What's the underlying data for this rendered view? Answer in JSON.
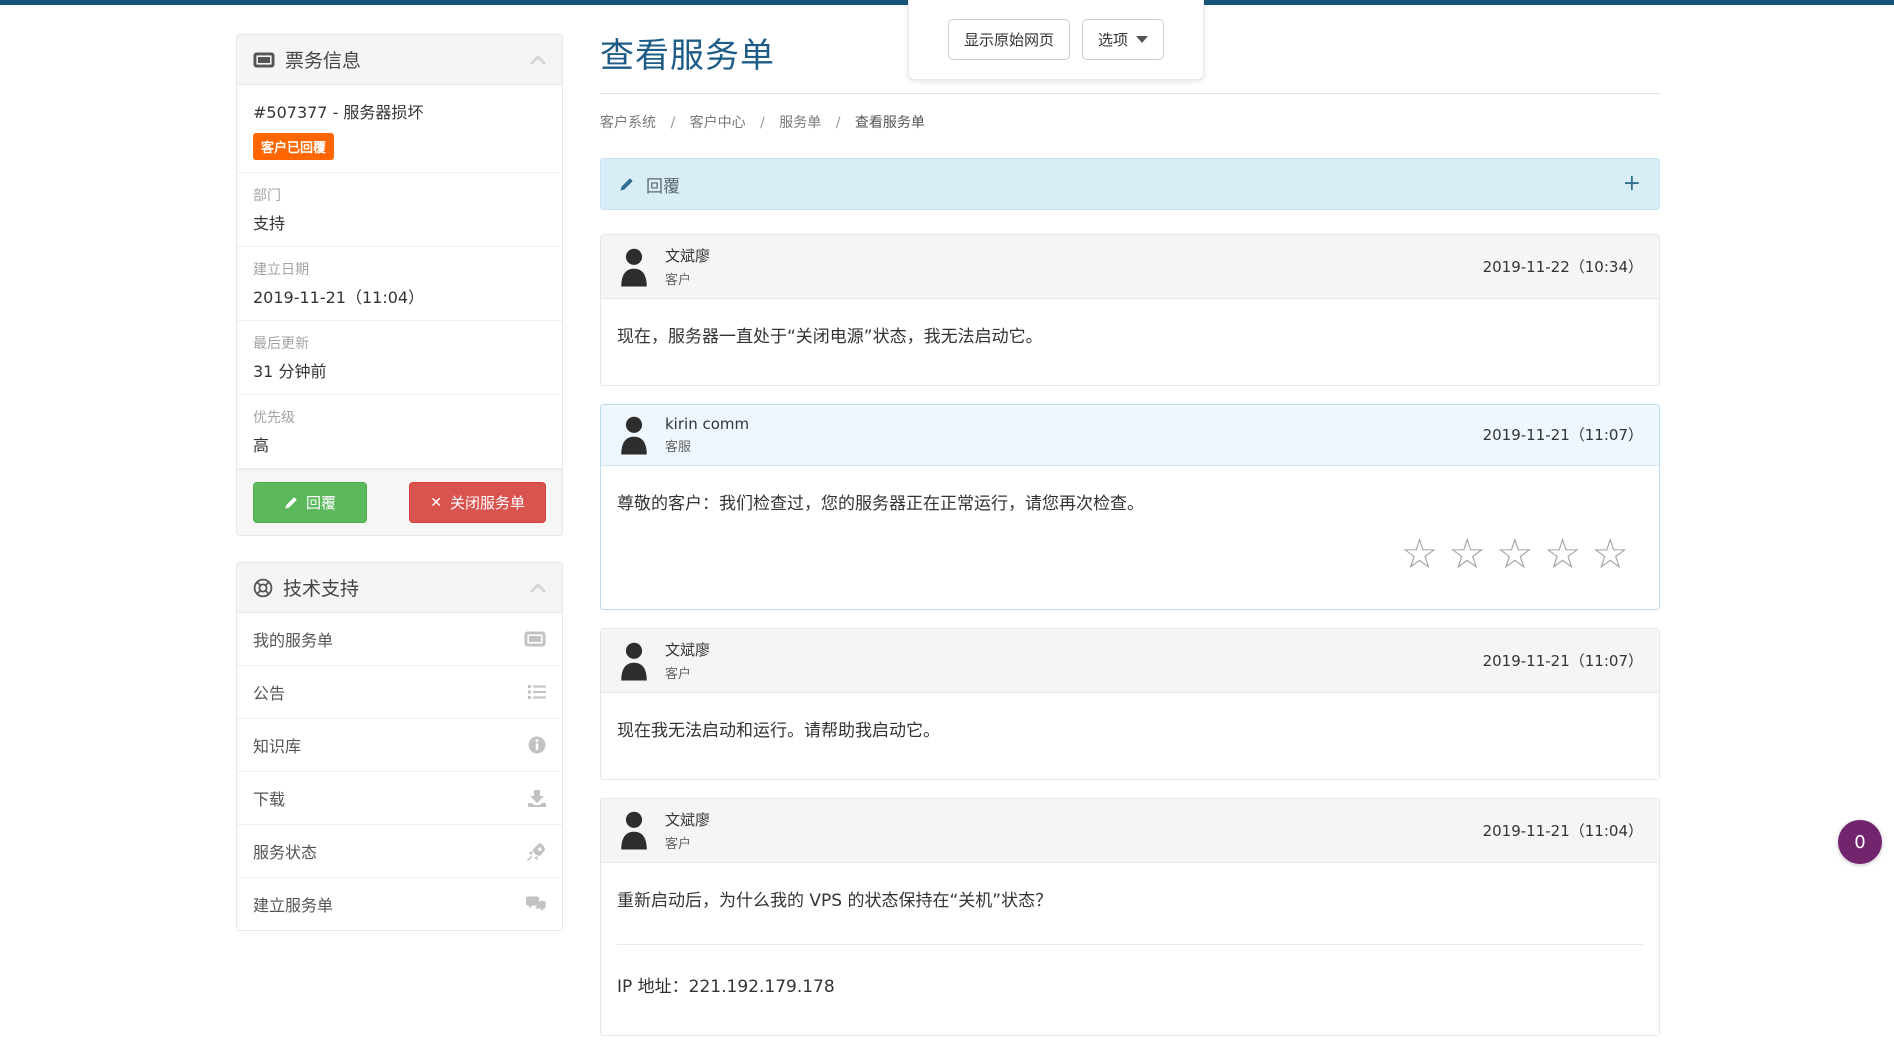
{
  "overlay_toolbar": {
    "show_original_label": "显示原始网页",
    "options_label": "选项"
  },
  "sidebar": {
    "ticket_panel": {
      "title": "票务信息",
      "ticket_id": "#507377 - 服务器损坏",
      "status_badge": "客户已回覆",
      "fields": [
        {
          "label": "部门",
          "value": "支持"
        },
        {
          "label": "建立日期",
          "value": "2019-11-21（11:04）"
        },
        {
          "label": "最后更新",
          "value": "31 分钟前"
        },
        {
          "label": "优先级",
          "value": "高"
        }
      ],
      "reply_button": "回覆",
      "close_button": "关闭服务单",
      "close_x": "✕"
    },
    "support_panel": {
      "title": "技术支持",
      "items": [
        {
          "label": "我的服务单",
          "icon": "ticket-icon"
        },
        {
          "label": "公告",
          "icon": "list-icon"
        },
        {
          "label": "知识库",
          "icon": "info-circle-icon"
        },
        {
          "label": "下载",
          "icon": "download-icon"
        },
        {
          "label": "服务状态",
          "icon": "rocket-icon"
        },
        {
          "label": "建立服务单",
          "icon": "comments-icon"
        }
      ]
    }
  },
  "main": {
    "page_title": "查看服务单",
    "breadcrumb": [
      "客户系统",
      "客户中心",
      "服务单",
      "查看服务单"
    ],
    "breadcrumb_separator": "/",
    "reply_bar": {
      "label": "回覆",
      "expand_glyph": "+"
    },
    "messages": [
      {
        "author": "文斌廖",
        "role": "客户",
        "date": "2019-11-22（10:34）",
        "body": "现在，服务器一直处于“关闭电源”状态，我无法启动它。"
      },
      {
        "author": "kirin comm",
        "role": "客服",
        "date": "2019-11-21（11:07）",
        "body": "尊敬的客户：我们检查过，您的服务器正在正常运行，请您再次检查。",
        "rating_max": 5
      },
      {
        "author": "文斌廖",
        "role": "客户",
        "date": "2019-11-21（11:07）",
        "body": "现在我无法启动和运行。请帮助我启动它。"
      },
      {
        "author": "文斌廖",
        "role": "客户",
        "date": "2019-11-21（11:04）",
        "body": "重新启动后，为什么我的 VPS 的状态保持在“关机”状态？",
        "body2": "IP 地址：221.192.179.178"
      }
    ]
  },
  "icons": {
    "star_glyph": "☆"
  },
  "floating_badge": {
    "count": "0"
  },
  "colors": {
    "topline": "#17527a",
    "title": "#1d5c87",
    "badge_orange": "#f60",
    "btn_green": "#5cb85c",
    "btn_red": "#d9534f",
    "reply_bar_bg": "#d9edf7",
    "staff_border": "#bedcf0",
    "float_badge": "#72246c"
  }
}
